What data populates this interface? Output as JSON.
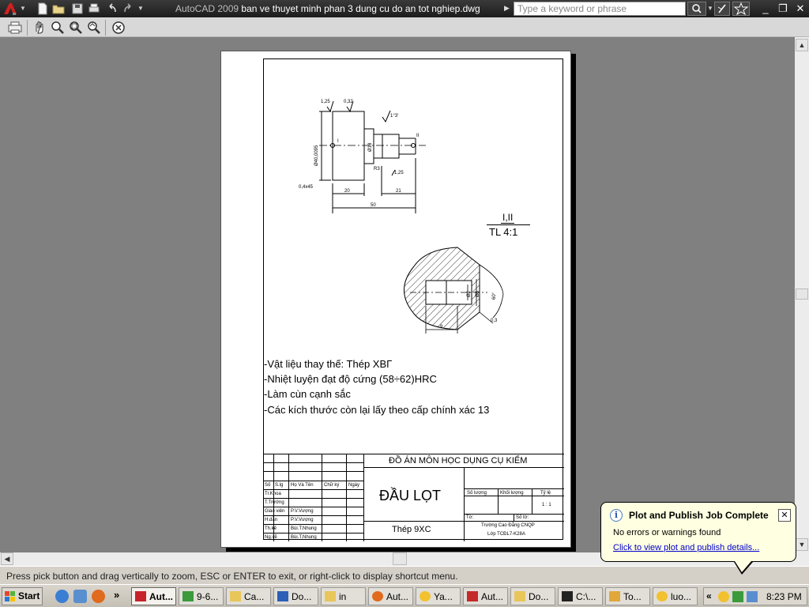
{
  "window": {
    "app_name": "AutoCAD 2009",
    "file_name": "ban ve thuyet minh phan 3 dung cu do an tot nghiep.dwg",
    "search_placeholder": "Type a keyword or phrase"
  },
  "drawing": {
    "part_dims": {
      "roughness_a": "1,25",
      "roughness_b": "0,32",
      "chamfer": "0,4x45",
      "dia_main": "Ø40,0095",
      "dim_20": "20",
      "dim_50": "50",
      "dim_21": "21",
      "r3": "R3",
      "dia_18": "Ø18",
      "roughness_c": "1,25",
      "angle": "1°3'",
      "mark_1": "I",
      "mark_2": "II"
    },
    "detail_label": "I,II",
    "detail_scale": "TL 4:1",
    "detail_dims": {
      "d2": "Ø2",
      "d5": "Ø5",
      "angle60": "60°",
      "len": "9",
      "small": "0,3"
    },
    "notes": [
      "-Vật liệu thay thế: Thép XBГ",
      "-Nhiệt luyện đạt độ cứng (58÷62)HRC",
      "-Làm cùn cạnh sắc",
      "-Các kích thước còn lại lấy theo cấp chính xác 13"
    ],
    "title_block": {
      "project": "ĐỒ ÁN MÔN HỌC DỤNG CỤ KIỂM",
      "part_name": "ĐẦU LỌT",
      "material": "Thép 9XC",
      "headers": [
        "Số",
        "S.lg",
        "Họ Và Tên",
        "Chữ ký",
        "Ngày"
      ],
      "roles": [
        "Tr.Khoa",
        "T.Trưởng",
        "Giáo viên",
        "H.dẫn",
        "Th.kế",
        "Ng.vẽ"
      ],
      "names": [
        "",
        "",
        "P.V.Vượng",
        "P.V.Vượng",
        "Bùi.T.Nhung",
        "Bùi.T.Nhung"
      ],
      "qty_label": "Số lượng",
      "mass_label": "Khối lượng",
      "scale_label": "Tỷ lệ",
      "scale_value": "1 : 1",
      "sheet_label": "Tờ:",
      "sheets_label": "Số tờ:",
      "school": "Trường Cao Đẳng CNQP",
      "class_name": "Lớp TCĐL7-K28A"
    }
  },
  "status_text": "Press pick button and drag vertically to zoom, ESC or ENTER to exit, or right-click to display shortcut menu.",
  "balloon": {
    "title": "Plot and Publish Job Complete",
    "message": "No errors or warnings found",
    "link": "Click to view plot and publish details..."
  },
  "taskbar": {
    "start": "Start",
    "tasks": [
      "Aut...",
      "9-6...",
      "Ca...",
      "Do...",
      "in",
      "Aut...",
      "Ya...",
      "Aut...",
      "Do...",
      "C:\\...",
      "To...",
      "luo..."
    ],
    "clock": "8:23 PM",
    "overflow": "»"
  }
}
